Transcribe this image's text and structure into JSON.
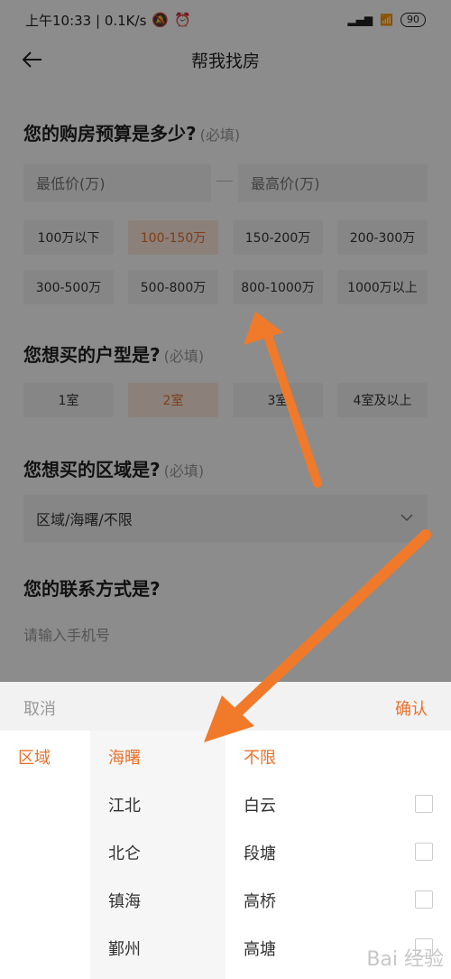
{
  "status": {
    "time_speed": "上午10:33 | 0.1K/s",
    "battery": "90"
  },
  "app": {
    "title": "帮我找房"
  },
  "budget": {
    "title": "您的购房预算是多少?",
    "required": "(必填)",
    "min_placeholder": "最低价(万)",
    "max_placeholder": "最高价(万)",
    "options": [
      "100万以下",
      "100-150万",
      "150-200万",
      "200-300万",
      "300-500万",
      "500-800万",
      "800-1000万",
      "1000万以上"
    ],
    "selected": "100-150万"
  },
  "layout": {
    "title": "您想买的户型是?",
    "required": "(必填)",
    "options": [
      "1室",
      "2室",
      "3室",
      "4室及以上"
    ],
    "selected": "2室"
  },
  "area": {
    "title": "您想买的区域是?",
    "required": "(必填)",
    "value": "区域/海曙/不限"
  },
  "contact": {
    "title": "您的联系方式是?",
    "phone_placeholder": "请输入手机号"
  },
  "sheet": {
    "cancel": "取消",
    "confirm": "确认",
    "col1": [
      "区域"
    ],
    "col2": [
      "海曙",
      "江北",
      "北仑",
      "镇海",
      "鄞州"
    ],
    "col3": [
      "不限",
      "白云",
      "段塘",
      "高桥",
      "高塘"
    ]
  },
  "colors": {
    "accent": "#e8702a",
    "annotation_arrow": "#f07a2a"
  },
  "watermark": "Bai 经验"
}
